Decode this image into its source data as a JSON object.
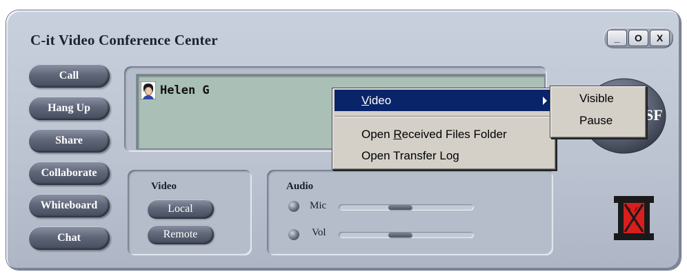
{
  "window": {
    "title": "C-it Video Conference Center",
    "controls": {
      "minimize": "_",
      "maximize": "O",
      "close": "X"
    }
  },
  "left_buttons": [
    "Call",
    "Hang Up",
    "Share",
    "Collaborate",
    "Whiteboard",
    "Chat"
  ],
  "participants": [
    {
      "name": "Helen G",
      "icon": "user-face-icon"
    }
  ],
  "video_section": {
    "label": "Video",
    "local": "Local",
    "remote": "Remote"
  },
  "audio_section": {
    "label": "Audio",
    "mic": {
      "label": "Mic",
      "level": 0.45
    },
    "vol": {
      "label": "Vol",
      "level": 0.45
    }
  },
  "context_menu": {
    "items": [
      {
        "pre": "",
        "accel": "V",
        "post": "ideo",
        "has_submenu": true,
        "selected": true
      },
      {
        "pre": "Open ",
        "accel": "R",
        "post": "eceived Files Folder",
        "has_submenu": false,
        "selected": false
      },
      {
        "pre": "Open Transfer Log",
        "accel": "",
        "post": "",
        "has_submenu": false,
        "selected": false
      }
    ]
  },
  "submenu": {
    "items": [
      "Visible",
      "Pause"
    ]
  },
  "wheel_label": "SF",
  "colors": {
    "menu_highlight": "#0a246a",
    "window_bg": "#bcc4d2",
    "logo_red": "#d81e1e"
  }
}
